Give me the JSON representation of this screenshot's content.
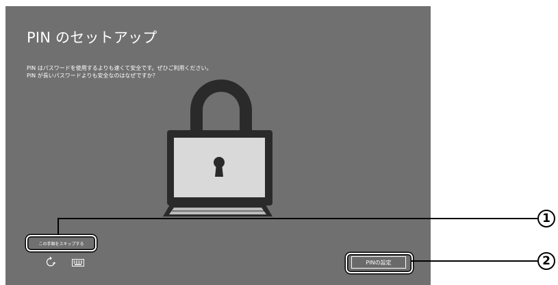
{
  "setup": {
    "title": "PIN のセットアップ",
    "description_line1": "PIN はパスワードを使用するよりも速くて安全です。ぜひご利用ください。",
    "description_line2": "PIN が長いパスワードよりも安全なのはなぜですか？",
    "illustration_icon": "padlock-computer",
    "skip_label": "この手順をスキップする",
    "pin_button_label": "PINの設定",
    "bottom_icons": [
      "ease-of-access-icon",
      "keyboard-icon"
    ]
  },
  "callouts": {
    "one": "1",
    "two": "2"
  },
  "colors": {
    "screen_background": "#707070",
    "text": "#ffffff",
    "illustration_dark": "#2a2a2a",
    "illustration_light": "#d9d9d9",
    "callout": "#000000"
  }
}
